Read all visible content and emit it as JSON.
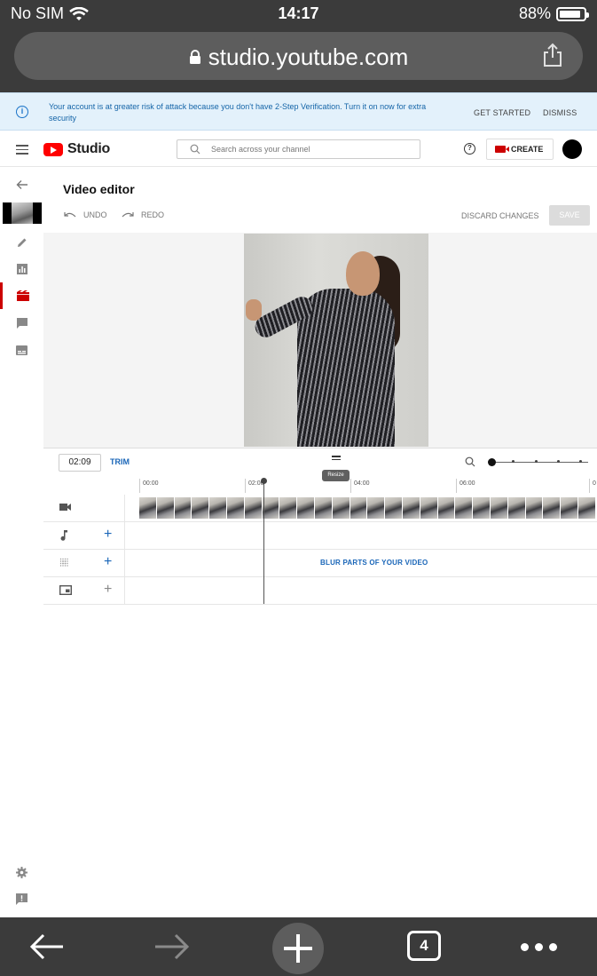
{
  "ios": {
    "carrier": "No SIM",
    "time": "14:17",
    "battery": "88%",
    "battery_level": 0.88,
    "url": "studio.youtube.com"
  },
  "alert": {
    "text": "Your account is at greater risk of attack because you don't have 2-Step Verification. Turn it on now for extra security",
    "get_started": "GET STARTED",
    "dismiss": "DISMISS"
  },
  "header": {
    "logo_text": "Studio",
    "search_placeholder": "Search across your channel",
    "create_label": "CREATE"
  },
  "editor": {
    "title": "Video editor",
    "undo": "UNDO",
    "redo": "REDO",
    "discard": "DISCARD CHANGES",
    "save": "SAVE"
  },
  "timeline": {
    "current_time": "02:09",
    "trim": "TRIM",
    "resize_tooltip": "Resize",
    "ruler": [
      "00:00",
      "02:00",
      "04:00",
      "06:00",
      "0"
    ],
    "blur_link": "BLUR PARTS OF YOUR VIDEO"
  },
  "colors": {
    "accent_blue": "#1a66b8",
    "brand_red": "#ff0000",
    "active_red": "#cc0000"
  }
}
